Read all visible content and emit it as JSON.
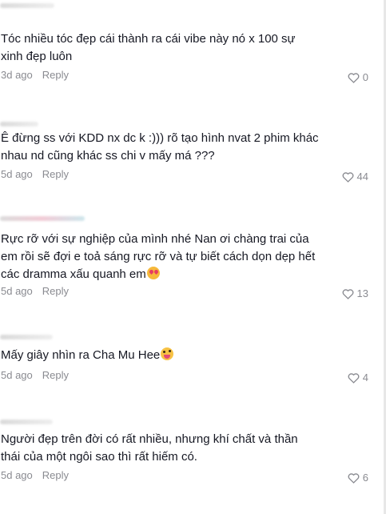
{
  "comments": [
    {
      "text": "Tóc nhiều tóc đẹp cái thành ra cái vibe này nó x 100 sự\nxinh đẹp luôn",
      "emoji": "",
      "time": "3d ago",
      "reply": "Reply",
      "likes": "0"
    },
    {
      "text": "Ê đừng ss với KDD nx dc k :))) rõ tạo hình nvat 2 phim khác\nnhau nd cũng khác ss chi v mấy má ???",
      "emoji": "",
      "time": "5d ago",
      "reply": "Reply",
      "likes": "44"
    },
    {
      "text": "Rực rỡ với sự nghiệp của mình nhé Nan ơi chàng trai của\nem rồi sẽ đợi e toả sáng rực rỡ và tự biết cách dọn dẹp hết\ncác dramma xấu quanh em",
      "emoji": "smiling-face-with-heart-eyes",
      "time": "5d ago",
      "reply": "Reply",
      "likes": "13"
    },
    {
      "text": "Mấy giây nhìn ra Cha Mu Hee",
      "emoji": "zany-face",
      "time": "5d ago",
      "reply": "Reply",
      "likes": "4"
    },
    {
      "text": "Người đẹp trên đời có rất nhiều, nhưng khí chất và thần\nthái của một ngôi sao thì rất hiếm có.",
      "emoji": "",
      "time": "5d ago",
      "reply": "Reply",
      "likes": "6"
    }
  ]
}
